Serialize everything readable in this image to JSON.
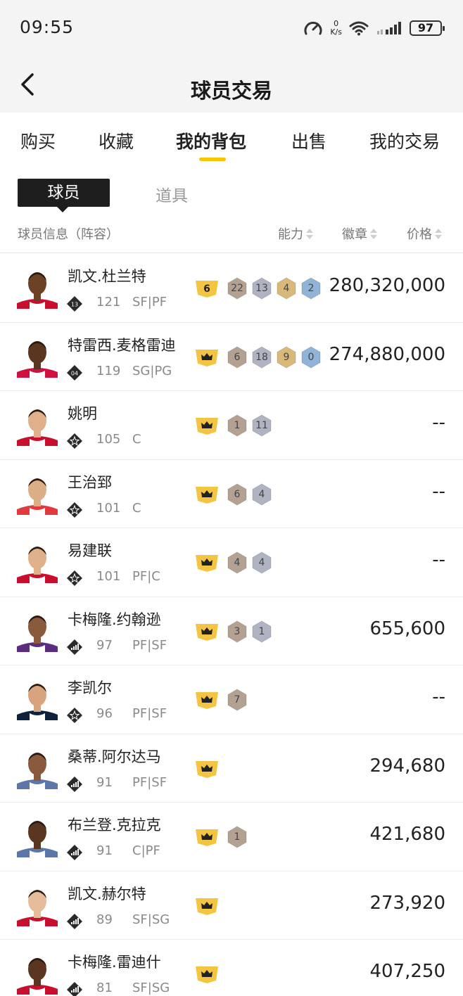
{
  "status": {
    "time": "09:55",
    "net_speed_value": "0",
    "net_speed_unit": "K/s",
    "battery": "97"
  },
  "header": {
    "title": "球员交易"
  },
  "tabs": [
    {
      "label": "购买"
    },
    {
      "label": "收藏"
    },
    {
      "label": "我的背包",
      "active": true
    },
    {
      "label": "出售"
    },
    {
      "label": "我的交易"
    }
  ],
  "subtabs": {
    "active": "球员",
    "other": "道具"
  },
  "columns": {
    "info": "球员信息（阵容）",
    "ability": "能力",
    "badge": "徽章",
    "price": "价格"
  },
  "players": [
    {
      "name": "凯文.杜兰特",
      "rating": "121",
      "position": "SF|PF",
      "tier_icon": "jersey-13-icon",
      "rank": "6",
      "badges": [
        {
          "value": "22",
          "color": "#b3a291"
        },
        {
          "value": "13",
          "color": "#b0b4c2"
        },
        {
          "value": "4",
          "color": "#d8b97a"
        },
        {
          "value": "2",
          "color": "#8fb4d8"
        }
      ],
      "price": "280,320,000"
    },
    {
      "name": "特雷西.麦格雷迪",
      "rating": "119",
      "position": "SG|PG",
      "tier_icon": "jersey-04-icon",
      "rank": "",
      "badges": [
        {
          "value": "6",
          "color": "#b3a291"
        },
        {
          "value": "18",
          "color": "#b0b4c2"
        },
        {
          "value": "9",
          "color": "#d8b97a"
        },
        {
          "value": "0",
          "color": "#8fb4d8"
        }
      ],
      "price": "274,880,000"
    },
    {
      "name": "姚明",
      "rating": "105",
      "position": "C",
      "tier_icon": "star-diamond-icon",
      "rank": "",
      "badges": [
        {
          "value": "1",
          "color": "#b3a291"
        },
        {
          "value": "11",
          "color": "#b0b4c2"
        }
      ],
      "price": "--"
    },
    {
      "name": "王治郅",
      "rating": "101",
      "position": "C",
      "tier_icon": "star-diamond-icon",
      "rank": "",
      "badges": [
        {
          "value": "6",
          "color": "#b3a291"
        },
        {
          "value": "4",
          "color": "#b0b4c2"
        }
      ],
      "price": "--"
    },
    {
      "name": "易建联",
      "rating": "101",
      "position": "PF|C",
      "tier_icon": "star-diamond-icon",
      "rank": "",
      "badges": [
        {
          "value": "4",
          "color": "#b3a291"
        },
        {
          "value": "4",
          "color": "#b0b4c2"
        }
      ],
      "price": "--"
    },
    {
      "name": "卡梅隆.约翰逊",
      "rating": "97",
      "position": "PF|SF",
      "tier_icon": "signal-diamond-icon",
      "rank": "",
      "badges": [
        {
          "value": "3",
          "color": "#b3a291"
        },
        {
          "value": "1",
          "color": "#b0b4c2"
        }
      ],
      "price": "655,600"
    },
    {
      "name": "李凯尔",
      "rating": "96",
      "position": "PF|SF",
      "tier_icon": "star-diamond-icon",
      "rank": "",
      "badges": [
        {
          "value": "7",
          "color": "#b3a291"
        }
      ],
      "price": "--"
    },
    {
      "name": "桑蒂.阿尔达马",
      "rating": "91",
      "position": "PF|SF",
      "tier_icon": "signal-diamond-icon",
      "rank": "",
      "badges": [],
      "price": "294,680"
    },
    {
      "name": "布兰登.克拉克",
      "rating": "91",
      "position": "C|PF",
      "tier_icon": "signal-diamond-icon",
      "rank": "",
      "badges": [
        {
          "value": "1",
          "color": "#b3a291"
        }
      ],
      "price": "421,680"
    },
    {
      "name": "凯文.赫尔特",
      "rating": "89",
      "position": "SF|SG",
      "tier_icon": "signal-diamond-icon",
      "rank": "",
      "badges": [],
      "price": "273,920"
    },
    {
      "name": "卡梅隆.雷迪什",
      "rating": "81",
      "position": "SF|SG",
      "tier_icon": "signal-diamond-icon",
      "rank": "",
      "badges": [],
      "price": "407,250"
    }
  ],
  "colors": {
    "accent": "#f7c600",
    "dark": "#1e1e1e"
  }
}
